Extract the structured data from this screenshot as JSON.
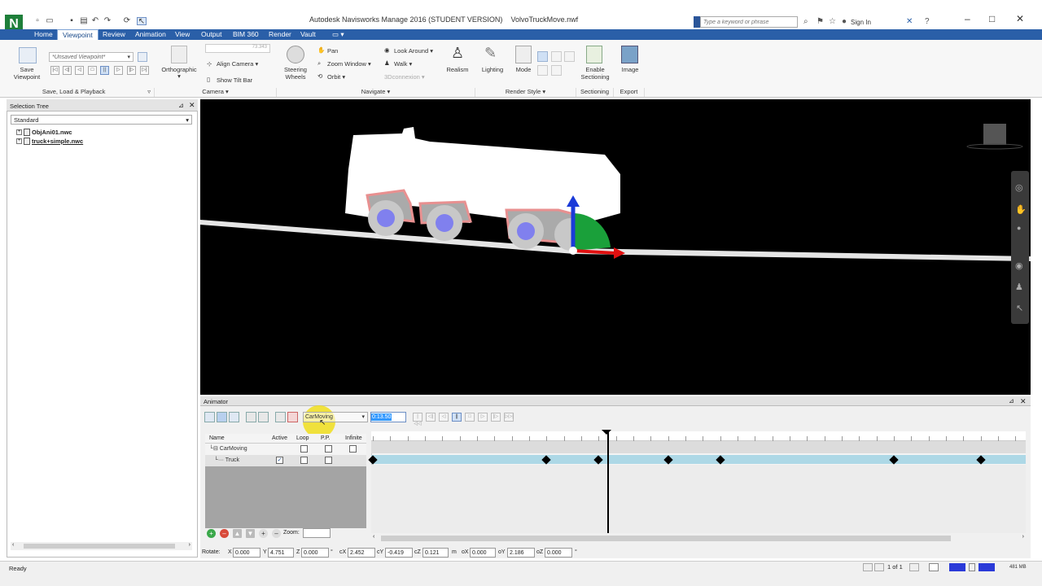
{
  "app": {
    "title": "Autodesk Navisworks Manage 2016 (STUDENT VERSION)",
    "filename": "VolvoTruckMove.nwf",
    "logo": "N",
    "search_placeholder": "Type a keyword or phrase",
    "sign_in": "Sign In"
  },
  "tabs": [
    "Home",
    "Viewpoint",
    "Review",
    "Animation",
    "View",
    "Output",
    "BIM 360",
    "Render",
    "Vault"
  ],
  "active_tab": "Viewpoint",
  "ribbon": {
    "save_viewpoint": "Save Viewpoint",
    "viewpoint_dropdown": "*Unsaved Viewpoint*",
    "group_save": "Save, Load & Playback",
    "orthographic": "Orthographic",
    "align_camera": "Align Camera",
    "show_tilt_bar": "Show Tilt Bar",
    "fov_value": "73.343",
    "group_camera": "Camera",
    "steering_wheels": "Steering Wheels",
    "pan": "Pan",
    "zoom_window": "Zoom Window",
    "orbit": "Orbit",
    "look_around": "Look Around",
    "walk": "Walk",
    "connexion": "3Dconnexion",
    "realism": "Realism",
    "group_navigate": "Navigate",
    "lighting": "Lighting",
    "mode": "Mode",
    "group_render_style": "Render Style",
    "enable_sectioning": "Enable Sectioning",
    "group_sectioning": "Sectioning",
    "image": "Image",
    "group_export": "Export"
  },
  "selection_tree": {
    "title": "Selection Tree",
    "dropdown": "Standard",
    "items": [
      "ObjAni01.nwc",
      "truck+simple.nwc"
    ]
  },
  "animator": {
    "title": "Animator",
    "scene_dropdown": "CarMoving",
    "time_value": "0:13.50",
    "zoom_label": "Zoom:",
    "columns": [
      "Name",
      "Active",
      "Loop",
      "P.P.",
      "Infinite"
    ],
    "rows": [
      {
        "name": "CarMoving",
        "active": false,
        "loop": false,
        "pp": false,
        "infinite": false
      },
      {
        "name": "Truck",
        "active": true,
        "loop": false,
        "pp": false
      }
    ],
    "keyframes_sec": [
      0,
      10,
      13,
      17,
      20,
      30,
      35
    ],
    "playhead_sec": 13.5,
    "timeline_max_sec": 37.5
  },
  "rotate_bar": {
    "label": "Rotate:",
    "fields": [
      {
        "label": "X",
        "value": "0.000"
      },
      {
        "label": "Y",
        "value": "4.751"
      },
      {
        "label": "Z",
        "value": "0.000"
      },
      {
        "label": "cX",
        "value": "2.452"
      },
      {
        "label": "cY",
        "value": "-0.419"
      },
      {
        "label": "cZ",
        "value": "0.121"
      },
      {
        "label": "oX",
        "value": "0.000"
      },
      {
        "label": "oY",
        "value": "2.186"
      },
      {
        "label": "oZ",
        "value": "0.000"
      }
    ],
    "deg": "°",
    "unit": "m"
  },
  "status": {
    "ready": "Ready",
    "pages": "1 of 1",
    "memory": "481 MB"
  },
  "colors": {
    "tab_blue": "#2a5fa8",
    "timeline_bar": "#add8e6",
    "logo_green": "#1e7f3a"
  }
}
